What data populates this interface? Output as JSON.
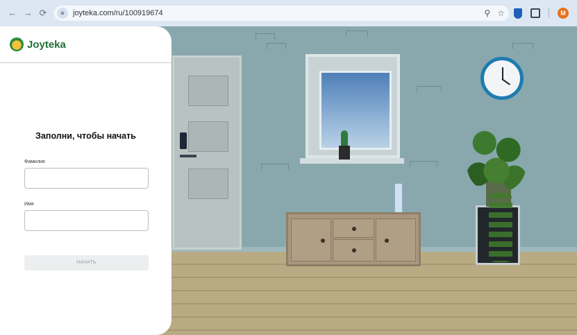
{
  "browser": {
    "url": "joyteka.com/ru/100919674",
    "avatar_letter": "M",
    "icons": {
      "back": "arrow-left-icon",
      "forward": "arrow-right-icon",
      "reload": "reload-icon",
      "site_info": "tune-icon",
      "zoom": "zoom-icon",
      "bookmark": "star-icon",
      "extension": "shield-icon",
      "extensions": "puzzle-icon",
      "menu": "kebab-menu-icon"
    }
  },
  "login": {
    "logo": "Joyteka",
    "title": "Заполни, чтобы начать",
    "surname_label": "Фамилия",
    "surname_value": "",
    "name_label": "Имя",
    "name_value": "",
    "start_button": "НАЧАТЬ"
  },
  "colors": {
    "brand_green": "#22713a",
    "wall": "#88a8ae",
    "chrome": "#dde7f3"
  }
}
